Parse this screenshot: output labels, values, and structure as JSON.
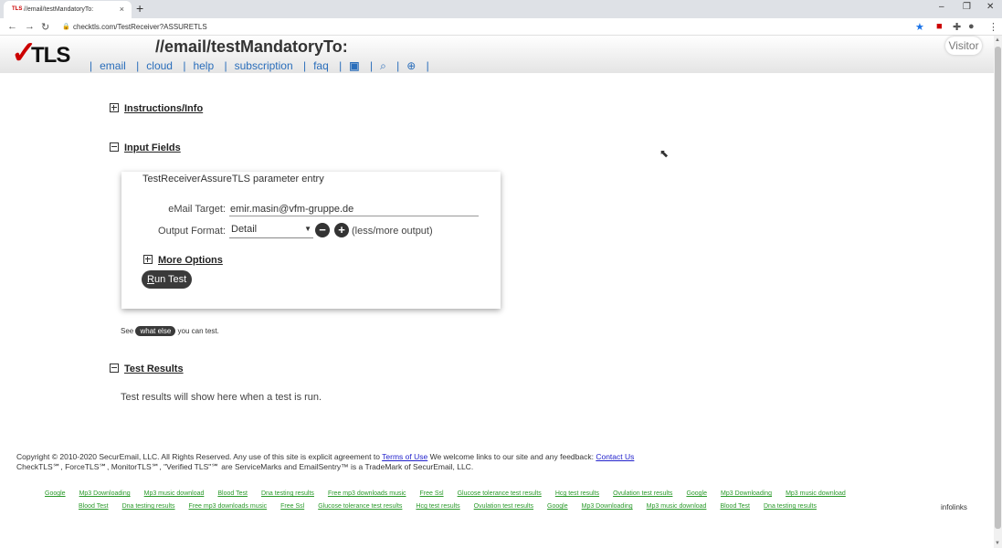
{
  "browser": {
    "tab_title": "//email/testMandatoryTo:",
    "tab_favicon": "TLS",
    "url": "checktls.com/TestReceiver?ASSURETLS"
  },
  "header": {
    "logo_text": "TLS",
    "page_title": "//email/testMandatoryTo:",
    "nav": [
      "email",
      "cloud",
      "help",
      "subscription",
      "faq"
    ],
    "visitor": "Visitor"
  },
  "sections": {
    "instructions": "Instructions/Info",
    "input_fields": "Input Fields",
    "test_results": "Test Results"
  },
  "form": {
    "panel_title": "TestReceiverAssureTLS parameter entry",
    "email_label": "eMail Target:",
    "email_value": "emir.masin@vfm-gruppe.de",
    "format_label": "Output Format:",
    "format_value": "Detail",
    "less_more": "(less/more output)",
    "more_options": "More Options",
    "run_test_first": "R",
    "run_test_rest": "un Test"
  },
  "see": {
    "prefix": "See",
    "pill": "what else",
    "suffix": "you can test."
  },
  "results_text": "Test results will show here when a test is run.",
  "footer": {
    "line1_a": "Copyright © 2010-2020 SecurEmail, LLC. All Rights Reserved. Any use of this site is explicit agreement to ",
    "terms": "Terms of Use",
    "line1_b": " We welcome links to our site and any feedback: ",
    "contact": "Contact Us",
    "line2": "CheckTLS℠, ForceTLS℠, MonitorTLS℠, \"Verified TLS\"℠ are ServiceMarks and EmailSentry™ is a TradeMark of SecurEmail, LLC."
  },
  "ad_links": {
    "row1": [
      "Google",
      "Mp3 Downloading",
      "Mp3 music download",
      "Blood Test",
      "Dna testing results",
      "Free mp3 downloads music",
      "Free Ssl",
      "Glucose tolerance test results",
      "Hcg test results",
      "Ovulation test results",
      "Google",
      "Mp3 Downloading",
      "Mp3 music download"
    ],
    "row2": [
      "Blood Test",
      "Dna testing results",
      "Free mp3 downloads music",
      "Free Ssl",
      "Glucose tolerance test results",
      "Hcg test results",
      "Ovulation test results",
      "Google",
      "Mp3 Downloading",
      "Mp3 music download",
      "Blood Test",
      "Dna testing results"
    ],
    "infolinks": "infolinks"
  }
}
